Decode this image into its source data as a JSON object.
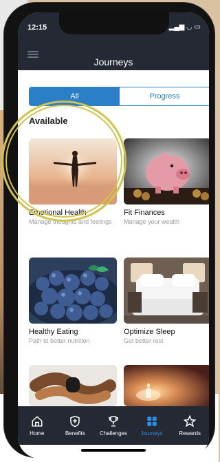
{
  "status": {
    "time": "12:15",
    "indicators": "▂▄▆ ◡ ▭"
  },
  "header": {
    "title": "Journeys"
  },
  "segment": {
    "all": "All",
    "progress": "Progress"
  },
  "section": {
    "title": "Available"
  },
  "cards": [
    {
      "title": "Emotional Health",
      "subtitle": "Manage thoughts and feelings"
    },
    {
      "title": "Fit Finances",
      "subtitle": "Manage your wealth"
    },
    {
      "title": "Healthy Eating",
      "subtitle": "Path to better nutrition"
    },
    {
      "title": "Optimize Sleep",
      "subtitle": "Get better rest"
    },
    {
      "title": "",
      "subtitle": ""
    },
    {
      "title": "",
      "subtitle": ""
    }
  ],
  "tabs": [
    {
      "label": "Home",
      "icon": "home-icon"
    },
    {
      "label": "Benefits",
      "icon": "shield-icon"
    },
    {
      "label": "Challenges",
      "icon": "trophy-icon"
    },
    {
      "label": "Journeys",
      "icon": "journeys-icon",
      "active": true
    },
    {
      "label": "Rewards",
      "icon": "star-icon"
    }
  ],
  "colors": {
    "accent": "#2b7fc6",
    "header": "#242933",
    "highlight": "#d1c34c"
  }
}
